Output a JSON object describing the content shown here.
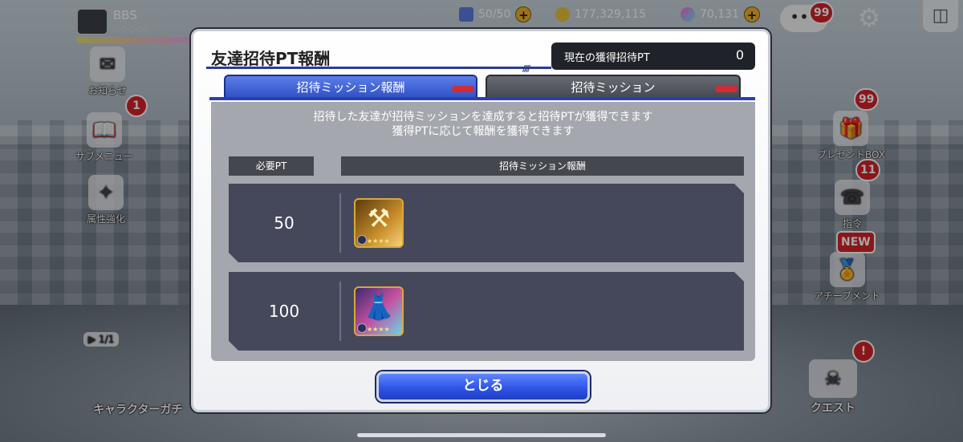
{
  "hud": {
    "player_name": "BBS",
    "player_stars": "◇◇◇◇◇",
    "stamina": "50/50",
    "coins": "177,329,115",
    "gems": "70,131",
    "chat_badge": "99"
  },
  "side_menu": {
    "news": {
      "label": "お知らせ"
    },
    "sub_menu": {
      "label": "サブメニュー",
      "badge": "1"
    },
    "attribute": {
      "label": "属性強化"
    },
    "present_box": {
      "label": "プレゼントBOX",
      "badge": "99"
    },
    "orders": {
      "label": "指令",
      "badge": "11"
    },
    "achievement": {
      "label": "アチーブメント",
      "badge": "NEW"
    },
    "gacha": {
      "label": "キャラクターガチ",
      "counter": "1/1"
    },
    "quest": {
      "label": "クエスト",
      "badge": "!"
    }
  },
  "modal": {
    "title": "友達招待PT報酬",
    "points_label": "現在の獲得招待PT",
    "points_value": "0",
    "tabs": [
      {
        "label": "招待ミッション報酬",
        "active": true
      },
      {
        "label": "招待ミッション",
        "active": false
      }
    ],
    "description_line1": "招待した友達が招待ミッションを達成すると招待PTが獲得できます",
    "description_line2": "獲得PTに応じて報酬を獲得できます",
    "table": {
      "headers": [
        "必要PT",
        "招待ミッション報酬"
      ],
      "rows": [
        {
          "pt": "50",
          "reward_icon": "golden-hammer-item-icon"
        },
        {
          "pt": "100",
          "reward_icon": "rainbow-dress-item-icon"
        }
      ]
    },
    "close_label": "とじる"
  },
  "colors": {
    "accent_blue": "#2f4fc4",
    "badge_red": "#d4232a",
    "panel_dark": "#45485b"
  }
}
